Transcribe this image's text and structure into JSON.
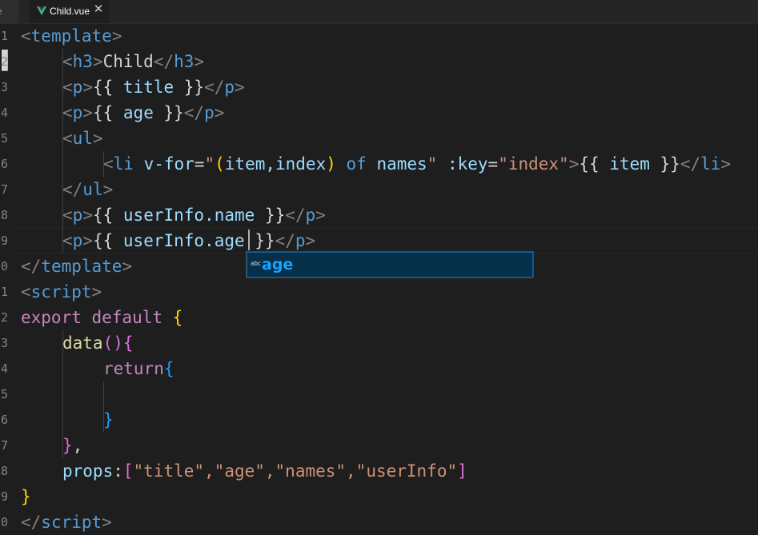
{
  "tabs": {
    "previous_fragment": "e",
    "active": {
      "label": "Child.vue",
      "icon": "vue-icon",
      "close_icon": "close-icon"
    }
  },
  "line_numbers": [
    "1",
    "2",
    "3",
    "4",
    "5",
    "6",
    "7",
    "8",
    "9",
    "0",
    "1",
    "2",
    "3",
    "4",
    "5",
    "6",
    "7",
    "8",
    "9",
    "0"
  ],
  "code": {
    "line1": {
      "open": "<",
      "tag": "template",
      "close": ">"
    },
    "line2": {
      "open": "<",
      "tag": "h3",
      "close": ">",
      "text": "Child",
      "end_open": "</",
      "end_tag": "h3",
      "end_close": ">"
    },
    "line3": {
      "open": "<",
      "tag": "p",
      "close": ">",
      "lbrace": "{{",
      "expr": " title ",
      "rbrace": "}}",
      "end_open": "</",
      "end_tag": "p",
      "end_close": ">"
    },
    "line4": {
      "open": "<",
      "tag": "p",
      "close": ">",
      "lbrace": "{{",
      "expr": " age ",
      "rbrace": "}}",
      "end_open": "</",
      "end_tag": "p",
      "end_close": ">"
    },
    "line5": {
      "open": "<",
      "tag": "ul",
      "close": ">"
    },
    "line6": {
      "open": "<",
      "tag": "li",
      "attr1": " v-for",
      "eq1": "=",
      "q1": "\"",
      "paren_open": "(",
      "item_index": "item,index",
      "paren_close": ")",
      "of_kw": " of ",
      "names": "names",
      "q2": "\"",
      "attr2": " :key",
      "eq2": "=",
      "str_index": "\"index\"",
      "close": ">",
      "lbrace": "{{",
      "expr": " item ",
      "rbrace": "}}",
      "end_open": "</",
      "end_tag": "li",
      "end_close": ">"
    },
    "line7": {
      "open": "</",
      "tag": "ul",
      "close": ">"
    },
    "line8": {
      "open": "<",
      "tag": "p",
      "close": ">",
      "lbrace": "{{",
      "expr": " userInfo.name ",
      "rbrace": "}}",
      "end_open": "</",
      "end_tag": "p",
      "end_close": ">"
    },
    "line9": {
      "open": "<",
      "tag": "p",
      "close": ">",
      "lbrace": "{{",
      "expr": " userInfo.age ",
      "rbrace": "}}",
      "end_open": "</",
      "end_tag": "p",
      "end_close": ">"
    },
    "line10": {
      "open": "</",
      "tag": "template",
      "close": ">"
    },
    "line11": {
      "open": "<",
      "tag": "script",
      "close": ">"
    },
    "line12": {
      "kw": "export default ",
      "brace": "{"
    },
    "line13": {
      "fn": "data",
      "parens": "()",
      "brace": "{"
    },
    "line14": {
      "kw": "return",
      "brace": "{"
    },
    "line15": {
      "text": ""
    },
    "line16": {
      "brace": "}"
    },
    "line17": {
      "brace": "}",
      "comma": ","
    },
    "line18": {
      "key": "props",
      "colon": ":",
      "lbracket": "[",
      "items": "\"title\",\"age\",\"names\",\"userInfo\"",
      "rbracket": "]"
    },
    "line19": {
      "brace": "}"
    },
    "line20": {
      "open": "</",
      "tag": "script",
      "close": ">"
    }
  },
  "suggest": {
    "kind_label": "abc",
    "item": "age"
  },
  "colors": {
    "background": "#1e1e1e",
    "tag": "#569cd6",
    "attribute": "#9cdcfe",
    "string": "#ce9178",
    "keyword": "#c586c0",
    "function": "#dcdcaa",
    "suggest_highlight": "#18a3ff"
  }
}
